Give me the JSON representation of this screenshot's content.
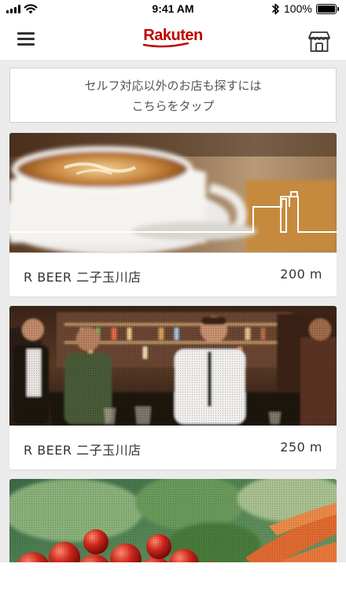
{
  "status_bar": {
    "time": "9:41 AM",
    "battery": "100%",
    "battery_level": 1.0
  },
  "nav": {
    "logo": "Rakuten",
    "menu_icon": "hamburger-menu-icon",
    "store_icon": "storefront-icon",
    "brand_color": "#bf0000"
  },
  "banner": {
    "line1": "セルフ対応以外のお店も探すには",
    "line2": "こちらをタップ"
  },
  "shops": [
    {
      "image": "coffee-latte-photo",
      "name": "R BEER 二子玉川店",
      "distance": "200 m"
    },
    {
      "image": "bar-staff-photo",
      "name": "R BEER 二子玉川店",
      "distance": "250 m"
    },
    {
      "image": "vegetables-photo"
    }
  ]
}
